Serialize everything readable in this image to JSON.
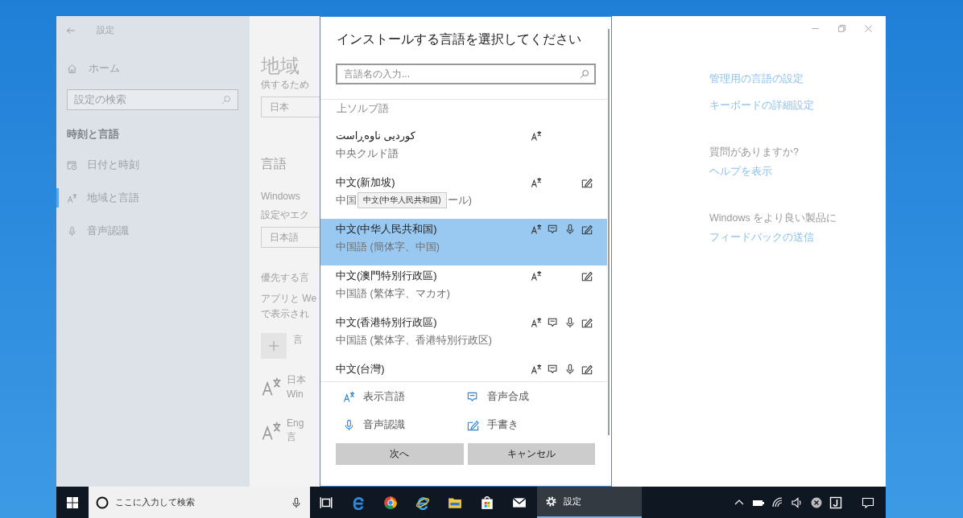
{
  "window": {
    "title": "設定"
  },
  "sidebar": {
    "home": "ホーム",
    "search_placeholder": "設定の検索",
    "section": "時刻と言語",
    "items": [
      {
        "kind": "calendar",
        "label": "日付と時刻",
        "selected": false
      },
      {
        "kind": "language",
        "label": "地域と言語",
        "selected": true
      },
      {
        "kind": "microphone",
        "label": "音声認識",
        "selected": false
      }
    ]
  },
  "main_page": {
    "heading": "地域",
    "description": "供するため",
    "country_dropdown": "日本",
    "section_title": "言語",
    "windows_label": "Windows",
    "windows_note": "設定やエク",
    "display_dropdown": "日本語",
    "preferred_title": "優先する言",
    "preferred_note": [
      "アプリと We",
      "で表示され"
    ],
    "add_label": "言",
    "languages": [
      {
        "name": "日本",
        "subtitle": "Win"
      },
      {
        "name": "Eng",
        "subtitle": "言"
      }
    ]
  },
  "dialog": {
    "title": "インストールする言語を選択してください",
    "search_placeholder": "言語名の入力...",
    "list_header": "上ソルブ語",
    "languages": [
      {
        "name": "کوردیی ناوەڕاست",
        "subtitle": "中央クルド語",
        "selected": false,
        "features": {
          "display": true,
          "tts": false,
          "speech": false,
          "handwriting": false
        }
      },
      {
        "name": "中文(新加坡)",
        "subtitle_parts": [
          "中国",
          "ール)"
        ],
        "tooltip": "中文(中华人民共和国)",
        "selected": false,
        "features": {
          "display": true,
          "tts": false,
          "speech": false,
          "handwriting": true
        }
      },
      {
        "name": "中文(中华人民共和国)",
        "subtitle": "中国語 (簡体字、中国)",
        "selected": true,
        "features": {
          "display": true,
          "tts": true,
          "speech": true,
          "handwriting": true
        }
      },
      {
        "name": "中文(澳門特別行政區)",
        "subtitle": "中国語 (繁体字、マカオ)",
        "selected": false,
        "features": {
          "display": true,
          "tts": false,
          "speech": false,
          "handwriting": true
        }
      },
      {
        "name": "中文(香港特別行政區)",
        "subtitle": "中国語 (繁体字、香港特別行政区)",
        "selected": false,
        "features": {
          "display": true,
          "tts": true,
          "speech": true,
          "handwriting": true
        }
      },
      {
        "name": "中文(台灣)",
        "selected": false,
        "features": {
          "display": true,
          "tts": true,
          "speech": true,
          "handwriting": true
        }
      }
    ],
    "legend": [
      {
        "kind": "display",
        "label": "表示言語"
      },
      {
        "kind": "tts",
        "label": "音声合成"
      },
      {
        "kind": "speech",
        "label": "音声認識"
      },
      {
        "kind": "handwriting",
        "label": "手書き"
      }
    ],
    "buttons": [
      "次へ",
      "キャンセル"
    ]
  },
  "right_panel": [
    {
      "kind": "link",
      "text": "管理用の言語の設定"
    },
    {
      "kind": "link",
      "text": "キーボードの詳細設定"
    },
    {
      "kind": "heading",
      "text": "質問がありますか?"
    },
    {
      "kind": "link",
      "text": "ヘルプを表示"
    },
    {
      "kind": "heading",
      "text": "Windows をより良い製品に"
    },
    {
      "kind": "link",
      "text": "フィードバックの送信"
    }
  ],
  "taskbar": {
    "search_placeholder": "ここに入力して検索",
    "active_app": "設定"
  }
}
